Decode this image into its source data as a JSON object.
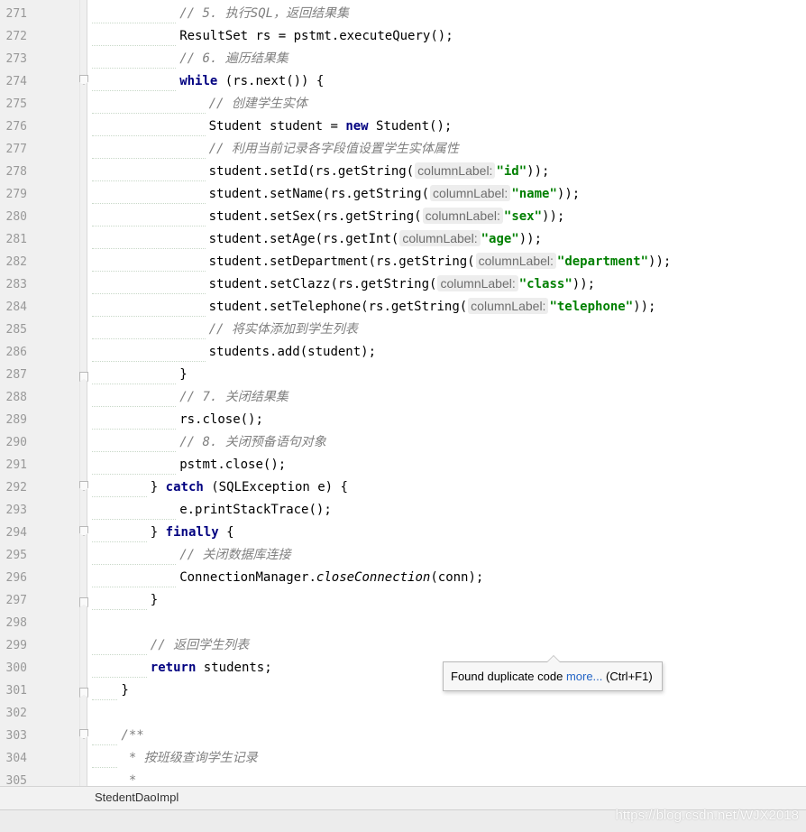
{
  "editor": {
    "lines": [
      {
        "n": "271",
        "fold": "",
        "indent": 13,
        "parts": [
          {
            "t": "// 5. 执行SQL，返回结果集",
            "c": "cm"
          }
        ]
      },
      {
        "n": "272",
        "fold": "",
        "indent": 13,
        "parts": [
          {
            "t": "ResultSet rs = pstmt.executeQuery();",
            "c": ""
          }
        ]
      },
      {
        "n": "273",
        "fold": "",
        "indent": 13,
        "parts": [
          {
            "t": "// 6. 遍历结果集",
            "c": "cm"
          }
        ]
      },
      {
        "n": "274",
        "fold": "start",
        "indent": 13,
        "parts": [
          {
            "t": "while",
            "c": "kw"
          },
          {
            "t": " (rs.next()) {",
            "c": ""
          }
        ]
      },
      {
        "n": "275",
        "fold": "",
        "indent": 17,
        "parts": [
          {
            "t": "// 创建学生实体",
            "c": "cm"
          }
        ]
      },
      {
        "n": "276",
        "fold": "",
        "indent": 17,
        "parts": [
          {
            "t": "Student student = ",
            "c": ""
          },
          {
            "t": "new",
            "c": "kw"
          },
          {
            "t": " Student();",
            "c": ""
          }
        ]
      },
      {
        "n": "277",
        "fold": "",
        "indent": 17,
        "parts": [
          {
            "t": "// 利用当前记录各字段值设置学生实体属性",
            "c": "cm"
          }
        ]
      },
      {
        "n": "278",
        "fold": "",
        "indent": 17,
        "parts": [
          {
            "t": "student.setId(rs.getString(",
            "c": ""
          },
          {
            "t": "columnLabel:",
            "c": "hint"
          },
          {
            "t": "\"id\"",
            "c": "str"
          },
          {
            "t": "));",
            "c": ""
          }
        ]
      },
      {
        "n": "279",
        "fold": "",
        "indent": 17,
        "parts": [
          {
            "t": "student.setName(rs.getString(",
            "c": ""
          },
          {
            "t": "columnLabel:",
            "c": "hint"
          },
          {
            "t": "\"name\"",
            "c": "str"
          },
          {
            "t": "));",
            "c": ""
          }
        ]
      },
      {
        "n": "280",
        "fold": "",
        "indent": 17,
        "parts": [
          {
            "t": "student.setSex(rs.getString(",
            "c": ""
          },
          {
            "t": "columnLabel:",
            "c": "hint"
          },
          {
            "t": "\"sex\"",
            "c": "str"
          },
          {
            "t": "));",
            "c": ""
          }
        ]
      },
      {
        "n": "281",
        "fold": "",
        "indent": 17,
        "parts": [
          {
            "t": "student.setAge(rs.getInt(",
            "c": ""
          },
          {
            "t": "columnLabel:",
            "c": "hint"
          },
          {
            "t": "\"age\"",
            "c": "str"
          },
          {
            "t": "));",
            "c": ""
          }
        ]
      },
      {
        "n": "282",
        "fold": "",
        "indent": 17,
        "parts": [
          {
            "t": "student.setDepartment(rs.getString(",
            "c": ""
          },
          {
            "t": "columnLabel:",
            "c": "hint"
          },
          {
            "t": "\"department\"",
            "c": "str"
          },
          {
            "t": "));",
            "c": ""
          }
        ]
      },
      {
        "n": "283",
        "fold": "",
        "indent": 17,
        "parts": [
          {
            "t": "student.setClazz(rs.getString(",
            "c": ""
          },
          {
            "t": "columnLabel:",
            "c": "hint"
          },
          {
            "t": "\"class\"",
            "c": "str"
          },
          {
            "t": "));",
            "c": ""
          }
        ]
      },
      {
        "n": "284",
        "fold": "",
        "indent": 17,
        "parts": [
          {
            "t": "student.setTelephone(rs.getString(",
            "c": ""
          },
          {
            "t": "columnLabel:",
            "c": "hint"
          },
          {
            "t": "\"telephone\"",
            "c": "str"
          },
          {
            "t": "));",
            "c": ""
          }
        ]
      },
      {
        "n": "285",
        "fold": "",
        "indent": 17,
        "parts": [
          {
            "t": "// 将实体添加到学生列表",
            "c": "cm"
          }
        ]
      },
      {
        "n": "286",
        "fold": "",
        "indent": 17,
        "parts": [
          {
            "t": "students.add(student);",
            "c": ""
          }
        ]
      },
      {
        "n": "287",
        "fold": "end",
        "indent": 13,
        "parts": [
          {
            "t": "}",
            "c": ""
          }
        ]
      },
      {
        "n": "288",
        "fold": "",
        "indent": 13,
        "parts": [
          {
            "t": "// 7. 关闭结果集",
            "c": "cm"
          }
        ]
      },
      {
        "n": "289",
        "fold": "",
        "indent": 13,
        "parts": [
          {
            "t": "rs.close();",
            "c": ""
          }
        ]
      },
      {
        "n": "290",
        "fold": "",
        "indent": 13,
        "parts": [
          {
            "t": "// 8. 关闭预备语句对象",
            "c": "cm"
          }
        ]
      },
      {
        "n": "291",
        "fold": "",
        "indent": 13,
        "parts": [
          {
            "t": "pstmt.close();",
            "c": ""
          }
        ]
      },
      {
        "n": "292",
        "fold": "start",
        "indent": 9,
        "parts": [
          {
            "t": "} ",
            "c": ""
          },
          {
            "t": "catch",
            "c": "kw"
          },
          {
            "t": " (SQLException e) {",
            "c": ""
          }
        ]
      },
      {
        "n": "293",
        "fold": "",
        "indent": 13,
        "parts": [
          {
            "t": "e.printStackTrace();",
            "c": ""
          }
        ]
      },
      {
        "n": "294",
        "fold": "start",
        "indent": 9,
        "parts": [
          {
            "t": "} ",
            "c": ""
          },
          {
            "t": "finally",
            "c": "kw"
          },
          {
            "t": " {",
            "c": ""
          }
        ]
      },
      {
        "n": "295",
        "fold": "",
        "indent": 13,
        "parts": [
          {
            "t": "// 关闭数据库连接",
            "c": "cm"
          }
        ]
      },
      {
        "n": "296",
        "fold": "",
        "indent": 13,
        "parts": [
          {
            "t": "ConnectionManager.",
            "c": ""
          },
          {
            "t": "closeConnection",
            "c": "it"
          },
          {
            "t": "(conn);",
            "c": ""
          }
        ]
      },
      {
        "n": "297",
        "fold": "end",
        "indent": 9,
        "parts": [
          {
            "t": "}",
            "c": ""
          }
        ]
      },
      {
        "n": "298",
        "fold": "",
        "indent": 0,
        "parts": []
      },
      {
        "n": "299",
        "fold": "",
        "indent": 9,
        "parts": [
          {
            "t": "// 返回学生列表",
            "c": "cm"
          }
        ]
      },
      {
        "n": "300",
        "fold": "",
        "indent": 9,
        "parts": [
          {
            "t": "return",
            "c": "kw"
          },
          {
            "t": " students;",
            "c": ""
          }
        ]
      },
      {
        "n": "301",
        "fold": "end",
        "indent": 5,
        "parts": [
          {
            "t": "}",
            "c": ""
          }
        ]
      },
      {
        "n": "302",
        "fold": "",
        "indent": 0,
        "parts": []
      },
      {
        "n": "303",
        "fold": "start",
        "indent": 5,
        "parts": [
          {
            "t": "/**",
            "c": "cm"
          }
        ]
      },
      {
        "n": "304",
        "fold": "",
        "indent": 5,
        "parts": [
          {
            "t": " * 按班级查询学生记录",
            "c": "cm"
          }
        ]
      },
      {
        "n": "305",
        "fold": "",
        "indent": 5,
        "parts": [
          {
            "t": " *",
            "c": "cm"
          }
        ]
      }
    ]
  },
  "tooltip": {
    "text": "Found duplicate code ",
    "link": "more...",
    "shortcut": " (Ctrl+F1)"
  },
  "breadcrumb": {
    "label": "StedentDaoImpl"
  },
  "watermark": {
    "text": "https://blog.csdn.net/WJX2018"
  }
}
